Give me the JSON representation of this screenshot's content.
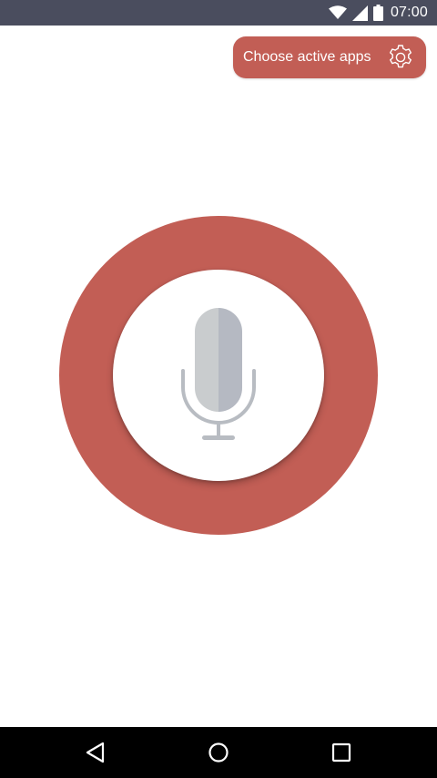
{
  "status_bar": {
    "time": "07:00",
    "icons": [
      "wifi-icon",
      "cell-signal-icon",
      "battery-icon"
    ]
  },
  "header": {
    "choose_apps_label": "Choose active apps",
    "settings_icon": "gear-icon"
  },
  "main": {
    "mic_icon": "microphone-icon"
  },
  "nav_bar": {
    "buttons": [
      "back-icon",
      "home-icon",
      "recents-icon"
    ]
  },
  "colors": {
    "status_bar": "#4a4d5e",
    "accent": "#c25e55",
    "mic_left": "#c9ccce",
    "mic_right": "#b5b9c2",
    "mic_stand": "#b8bcc2",
    "nav_bar": "#000000"
  }
}
